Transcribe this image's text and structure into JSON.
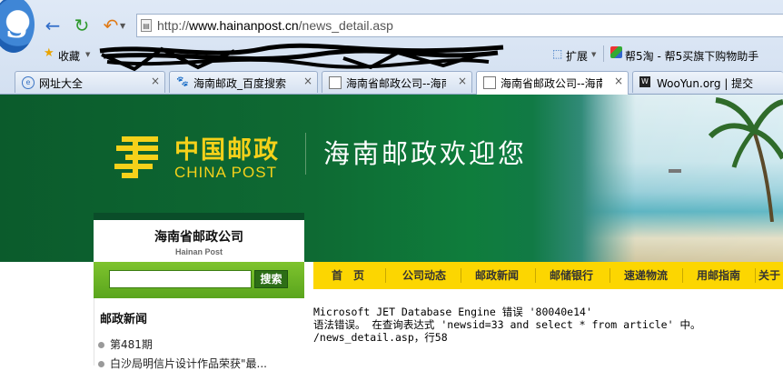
{
  "browser": {
    "address": {
      "scheme": "http://",
      "host": "www.hainanpost.cn",
      "path": "/news_detail.asp"
    },
    "bookmarks": {
      "favorites_label": "收藏",
      "expand_label": "扩展",
      "helper_label": "帮5淘 - 帮5买旗下购物助手"
    },
    "tabs": [
      {
        "label": "网址大全",
        "icon": "globe-icon"
      },
      {
        "label": "海南邮政_百度搜索",
        "icon": "paw-icon"
      },
      {
        "label": "海南省邮政公司--海南",
        "icon": "page-icon"
      },
      {
        "label": "海南省邮政公司--海南",
        "icon": "page-icon",
        "active": true
      },
      {
        "label": "WooYun.org | 提交",
        "icon": "wooyun-icon"
      }
    ],
    "close_glyph": "×"
  },
  "banner": {
    "logo_cn": "中国邮政",
    "logo_en": "CHINA POST",
    "welcome": "海南邮政欢迎您"
  },
  "brand": {
    "name_cn": "海南省邮政公司",
    "name_en": "Hainan Post"
  },
  "search": {
    "button_label": "搜索",
    "value": ""
  },
  "menu": [
    "首　页",
    "公司动态",
    "邮政新闻",
    "邮储银行",
    "速递物流",
    "用邮指南",
    "关于"
  ],
  "left": {
    "section_title": "邮政新闻",
    "items": [
      "第481期",
      "白沙局明信片设计作品荣获\"最..."
    ]
  },
  "error": {
    "line1": "Microsoft JET Database Engine 错误 '80040e14'",
    "line2": "语法错误。 在查询表达式 'newsid=33 and select * from article' 中。",
    "line3": "/news_detail.asp，行58"
  },
  "colors": {
    "banner_green": "#0e6a33",
    "menu_yellow": "#fcd601",
    "logo_yellow": "#f5d11a",
    "search_green": "#6db526"
  }
}
